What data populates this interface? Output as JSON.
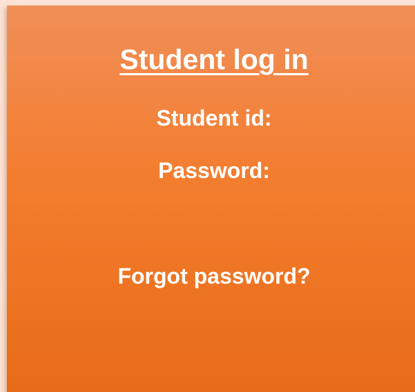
{
  "login": {
    "title": "Student log in",
    "student_id_label": "Student id:",
    "password_label": "Password:",
    "forgot_password_link": "Forgot password?"
  }
}
